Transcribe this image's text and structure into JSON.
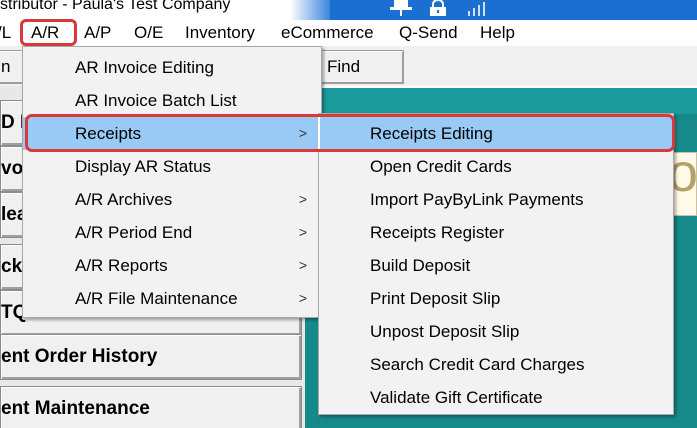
{
  "window": {
    "title": "stributor - Paula's Test Company"
  },
  "menubar": {
    "items": [
      "/L",
      "A/R",
      "A/P",
      "O/E",
      "Inventory",
      "eCommerce",
      "Q-Send",
      "Help"
    ],
    "active": "A/R"
  },
  "toolbar": {
    "left_label": "n",
    "find_label": "Find"
  },
  "left_buttons": {
    "btn1": "D E",
    "btn2": "voi",
    "btn3": "lea",
    "btn4": "ck",
    "btn5": "TQ",
    "btn6": "ent Order History",
    "btn7": "ent Maintenance"
  },
  "ar_menu": {
    "items": [
      {
        "label": "AR Invoice Editing",
        "submenu": false
      },
      {
        "label": "AR Invoice Batch List",
        "submenu": false
      },
      {
        "label": "Receipts",
        "submenu": true
      },
      {
        "label": "Display AR Status",
        "submenu": false
      },
      {
        "label": "A/R Archives",
        "submenu": true
      },
      {
        "label": "A/R Period End",
        "submenu": true
      },
      {
        "label": "A/R Reports",
        "submenu": true
      },
      {
        "label": "A/R File Maintenance",
        "submenu": true
      }
    ],
    "arrow_glyph": ">"
  },
  "receipts_submenu": {
    "items": [
      "Receipts Editing",
      "Open Credit Cards",
      "Import PayByLink Payments",
      "Receipts Register",
      "Build Deposit",
      "Print Deposit Slip",
      "Unpost Deposit Slip",
      "Search Credit Card Charges",
      "Validate Gift Certificate"
    ]
  },
  "logo": {
    "partial_letter": "o"
  },
  "colors": {
    "highlight_red": "#d83a3a",
    "selection_blue": "#99c9f5",
    "teal_background": "#168a8a",
    "title_accent": "#1a6fd0"
  },
  "icons": [
    "pin-icon",
    "lock-icon",
    "signal-icon",
    "chevron-right-icon"
  ]
}
